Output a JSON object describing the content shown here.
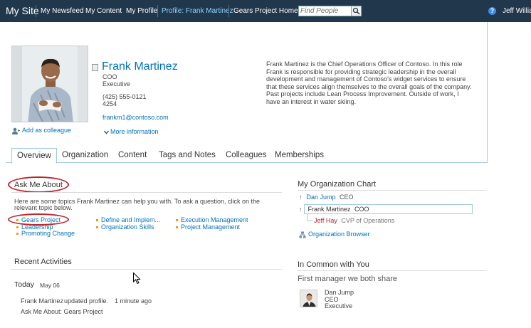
{
  "topnav": {
    "site_title": "My Site",
    "items": [
      "My Newsfeed",
      "My Content",
      "My Profile",
      "Profile: Frank Martinez",
      "Gears Project Home"
    ],
    "search_placeholder": "Find People",
    "user": "Jeff Willia",
    "help_glyph": "?"
  },
  "profile": {
    "name": "Frank Martinez",
    "title": "COO",
    "department": "Executive",
    "phone": "(425) 555-0121",
    "extension": "4254",
    "email": "frankm1@contoso.com",
    "add_colleague": "Add as colleague",
    "more_info": "More information",
    "bio": "Frank Martinez is the Chief Operations Officer of Contoso. In this role Frank is responsible for providing strategic leadership in the overall development and management of Contoso's widget services to ensure that these services align themselves to the overall goals of the company. Past projects include Lean Process Improvement. Outside of work, I have an interest in water skiing."
  },
  "tabs": [
    "Overview",
    "Organization",
    "Content",
    "Tags and Notes",
    "Colleagues",
    "Memberships"
  ],
  "ask_me_about": {
    "heading": "Ask Me About",
    "intro_line1": "Here are some topics Frank Martinez can help you with. To ask a question, click on the",
    "intro_line2": "relevant topic below.",
    "topics": [
      "Gears Project",
      "Leadership",
      "Promoting Change",
      "Define and Implem...",
      "Organization Skills",
      "Execution Management",
      "Project Management"
    ]
  },
  "recent_activities": {
    "heading": "Recent Activities",
    "day": "Today",
    "date": "May 06",
    "actor": "Frank Martinez",
    "action": "updated profile.",
    "time": "1 minute ago",
    "detail": "Ask Me About: Gears Project"
  },
  "org_chart": {
    "heading": "My Organization Chart",
    "rows": [
      {
        "name": "Dan Jump",
        "title": "CEO"
      },
      {
        "name": "Frank Martinez",
        "title": "COO"
      },
      {
        "name": "Jeff Hay",
        "title": "CVP of Operations"
      }
    ],
    "browser_link": "Organization Browser"
  },
  "in_common": {
    "heading": "In Common with You",
    "subheading": "First manager we both share",
    "name": "Dan Jump",
    "title": "CEO",
    "department": "Executive"
  },
  "icons": {
    "search": "search-icon",
    "help": "help-icon",
    "add_colleague": "add-colleague-icon",
    "chevron": "chevron-down-icon",
    "org_browser": "org-browser-icon",
    "up_arrow": "up-arrow-icon"
  },
  "colors": {
    "topbar": "#21374c",
    "link": "#0072bc",
    "active_nav": "#8fd4ff",
    "annotation_red": "#c0272d",
    "bullet_orange": "#f7941d"
  }
}
